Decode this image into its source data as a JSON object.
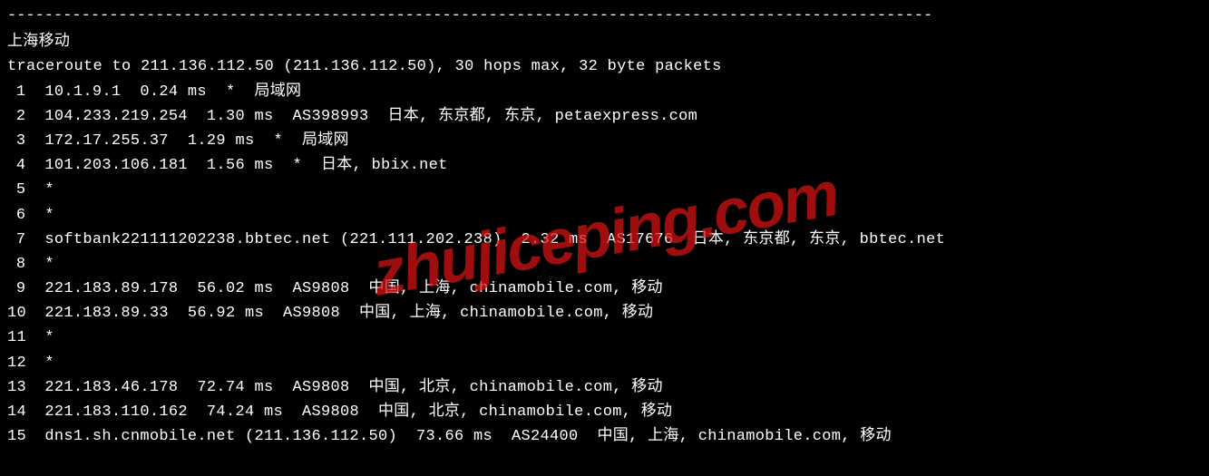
{
  "separator": "----------------------------------------------------------------------------------------------------",
  "title": "上海移动",
  "header": "traceroute to 211.136.112.50 (211.136.112.50), 30 hops max, 32 byte packets",
  "hops": [
    {
      "num": "1",
      "text": "10.1.9.1  0.24 ms  *  局域网"
    },
    {
      "num": "2",
      "text": "104.233.219.254  1.30 ms  AS398993  日本, 东京都, 东京, petaexpress.com"
    },
    {
      "num": "3",
      "text": "172.17.255.37  1.29 ms  *  局域网"
    },
    {
      "num": "4",
      "text": "101.203.106.181  1.56 ms  *  日本, bbix.net"
    },
    {
      "num": "5",
      "text": "*"
    },
    {
      "num": "6",
      "text": "*"
    },
    {
      "num": "7",
      "text": "softbank221111202238.bbtec.net (221.111.202.238)  2.32 ms  AS17676  日本, 东京都, 东京, bbtec.net"
    },
    {
      "num": "8",
      "text": "*"
    },
    {
      "num": "9",
      "text": "221.183.89.178  56.02 ms  AS9808  中国, 上海, chinamobile.com, 移动"
    },
    {
      "num": "10",
      "text": "221.183.89.33  56.92 ms  AS9808  中国, 上海, chinamobile.com, 移动"
    },
    {
      "num": "11",
      "text": "*"
    },
    {
      "num": "12",
      "text": "*"
    },
    {
      "num": "13",
      "text": "221.183.46.178  72.74 ms  AS9808  中国, 北京, chinamobile.com, 移动"
    },
    {
      "num": "14",
      "text": "221.183.110.162  74.24 ms  AS9808  中国, 北京, chinamobile.com, 移动"
    },
    {
      "num": "15",
      "text": "dns1.sh.cnmobile.net (211.136.112.50)  73.66 ms  AS24400  中国, 上海, chinamobile.com, 移动"
    }
  ],
  "watermark": "zhujiceping.com"
}
